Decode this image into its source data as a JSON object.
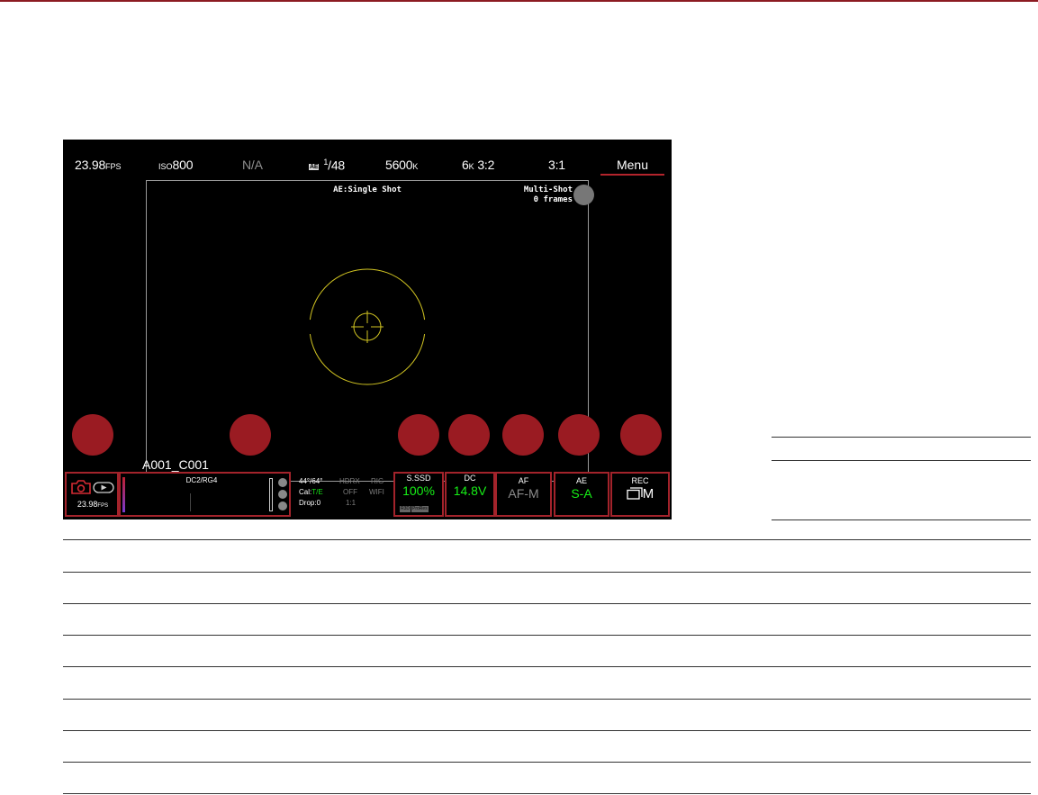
{
  "screen": {
    "stats": {
      "fps_value": "23.98",
      "fps_unit": "FPS",
      "iso_prefix": "ISO",
      "iso_value": "800",
      "aperture": "N/A",
      "shutter_badge": "AE",
      "shutter_num": "1",
      "shutter_den": "/48",
      "white_balance_value": "5600",
      "white_balance_unit": "K",
      "format_value": "6",
      "format_unit": "K",
      "format_aspect": "3:2",
      "compression": "3:1"
    },
    "menu_label": "Menu",
    "ae_mode": "AE:Single Shot",
    "multishot": {
      "line1": "Multi-Shot",
      "line2": "0 frames"
    },
    "clip_name": "A001_C001",
    "status_bar": {
      "record_fps_value": "23.98",
      "record_fps_unit": "FPS",
      "histogram_label": "DC2/RG4",
      "temp": "44°/64°",
      "cal_prefix": "Cal:",
      "cal_value": "T/E",
      "drop": "Drop:0",
      "hdrx_label": "HDRX",
      "hdrx_value": "OFF",
      "ratio_value": "1:1",
      "rig_label": "RIG",
      "wifi_label": "WIFI",
      "media": {
        "label": "S.SSD",
        "value": "100%",
        "tag1": "R3D",
        "tag2": "ProRes"
      },
      "power": {
        "label": "DC",
        "value": "14.8V"
      },
      "af": {
        "label": "AF",
        "value": "AF-M"
      },
      "ae": {
        "label": "AE",
        "value": "S-A"
      },
      "rec": {
        "label": "REC",
        "value": "M"
      }
    }
  },
  "colors": {
    "accent_red": "#a3232b",
    "status_green": "#16f016",
    "reticle_yellow": "#d2c522"
  }
}
